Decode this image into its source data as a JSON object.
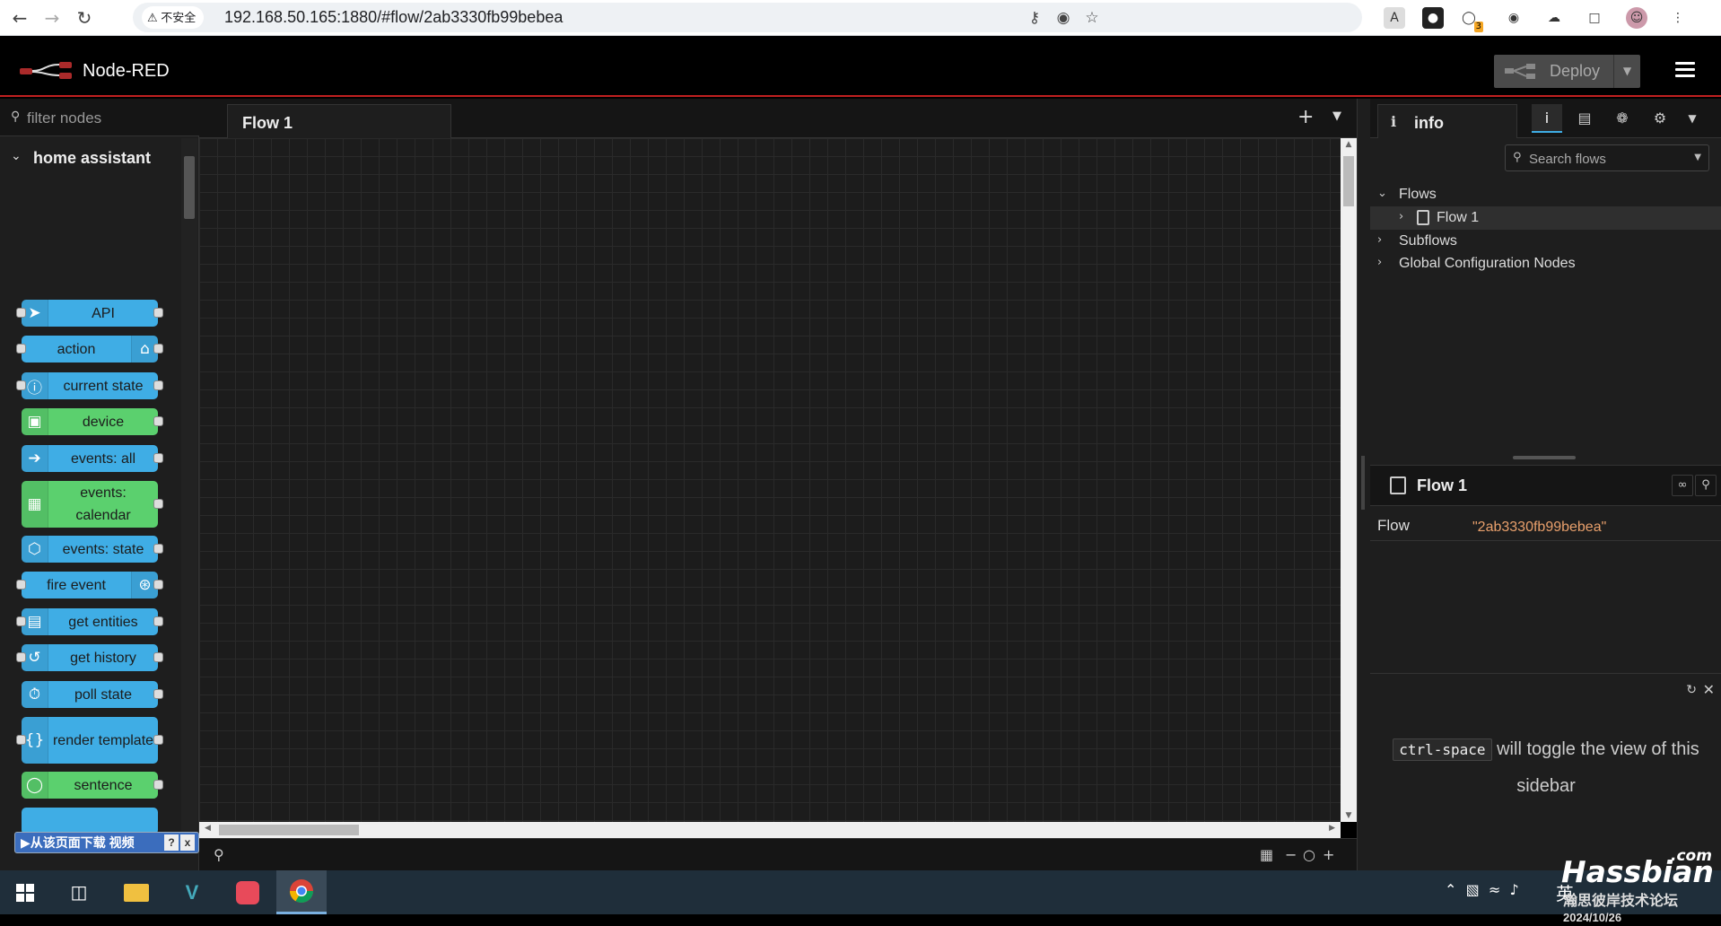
{
  "browser": {
    "insecure_label": "不安全",
    "url": "192.168.50.165:1880/#flow/2ab3330fb99bebea",
    "extension_badge": "3"
  },
  "header": {
    "app_title": "Node-RED",
    "deploy_label": "Deploy"
  },
  "palette": {
    "filter_placeholder": "filter nodes",
    "category": "home assistant",
    "nodes": [
      {
        "label": "API",
        "color": "#3fade5",
        "icon": "paper-plane-icon"
      },
      {
        "label": "action",
        "color": "#3fade5",
        "icon": "router-icon"
      },
      {
        "label": "current state",
        "color": "#3fade5",
        "icon": "info-icon"
      },
      {
        "label": "device",
        "color": "#5bd06e",
        "icon": "cube-icon"
      },
      {
        "label": "events: all",
        "color": "#3fade5",
        "icon": "arrow-right-icon"
      },
      {
        "label": "events: calendar",
        "color": "#5bd06e",
        "icon": "calendar-icon"
      },
      {
        "label": "events: state",
        "color": "#3fade5",
        "icon": "hexagon-icon"
      },
      {
        "label": "fire event",
        "color": "#3fade5",
        "icon": "broadcast-icon"
      },
      {
        "label": "get entities",
        "color": "#3fade5",
        "icon": "entities-icon"
      },
      {
        "label": "get history",
        "color": "#3fade5",
        "icon": "history-icon"
      },
      {
        "label": "poll state",
        "color": "#3fade5",
        "icon": "timer-icon"
      },
      {
        "label": "render template",
        "color": "#3fade5",
        "icon": "braces-icon"
      },
      {
        "label": "sentence",
        "color": "#5bd06e",
        "icon": "speech-bubble-icon"
      }
    ]
  },
  "download_bar": {
    "label": "从该页面下载 视频",
    "help": "?",
    "close": "x"
  },
  "workspace": {
    "tab_label": "Flow 1"
  },
  "sidebar": {
    "tab_label": "info",
    "search_placeholder": "Search flows",
    "tree": {
      "flows": "Flows",
      "flow1": "Flow 1",
      "subflows": "Subflows",
      "global_config": "Global Configuration Nodes"
    },
    "detail": {
      "title": "Flow 1",
      "key": "Flow",
      "value": "\"2ab3330fb99bebea\""
    },
    "tip": {
      "code": "ctrl-space",
      "text": "will toggle the view of this sidebar"
    }
  },
  "watermark": {
    "brand": "Hassbian",
    "suffix": ".com",
    "sub": "瀚思彼岸技术论坛"
  },
  "taskbar": {
    "ime": "英",
    "date": "2024/10/26"
  }
}
